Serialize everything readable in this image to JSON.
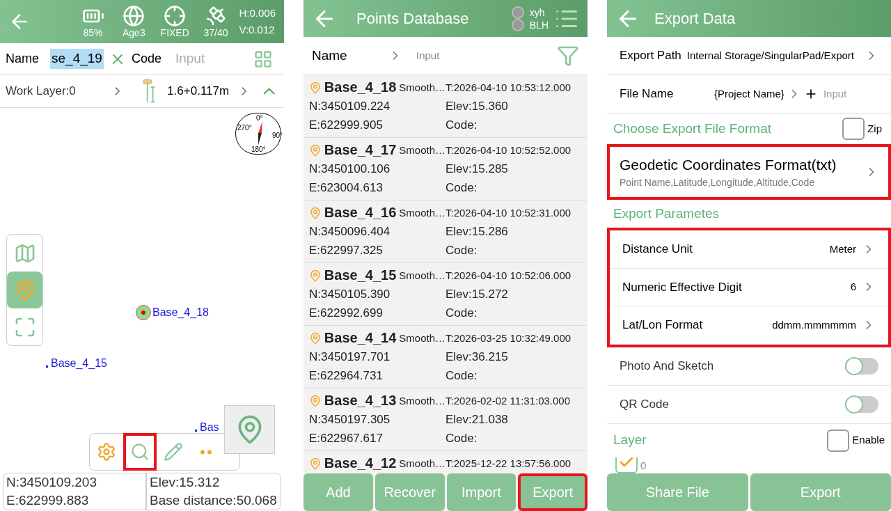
{
  "survey_screen": {
    "status": [
      {
        "kind": "battery",
        "label": "85%"
      },
      {
        "kind": "globe",
        "label": "Age3"
      },
      {
        "kind": "target",
        "label": "FIXED"
      },
      {
        "kind": "satellite",
        "label": "37/40"
      }
    ],
    "precision": [
      "H:0.006",
      "V:0.012"
    ],
    "name_label": "Name",
    "name_value": "se_4_19",
    "code_label": "Code",
    "code_placeholder": "Input",
    "work_layer": "Work Layer:0",
    "antenna_height": "1.6+0.117m",
    "compass": [
      "0°",
      "90°",
      "180°",
      "270°"
    ],
    "map_points": [
      {
        "label": "Base_4_18",
        "kind": "current"
      },
      {
        "label": "Base_4_15",
        "kind": "point"
      },
      {
        "label": "Bas",
        "kind": "point"
      }
    ],
    "side_tools": [
      {
        "kind": "polygon",
        "selected": false
      },
      {
        "kind": "locate",
        "selected": true
      },
      {
        "kind": "fit",
        "selected": false
      }
    ],
    "toolbar": [
      {
        "kind": "settings",
        "highlighted": false
      },
      {
        "kind": "point-search",
        "highlighted": true
      },
      {
        "kind": "sketch",
        "highlighted": false
      },
      {
        "kind": "more",
        "highlighted": false
      }
    ],
    "info": [
      "N:3450109.203",
      "Elev:15.312",
      "E:622999.883",
      "Base distance:50.068"
    ]
  },
  "points_database": {
    "title": "Points Database",
    "modes": [
      {
        "label": "xyh",
        "selected": false
      },
      {
        "label": "BLH",
        "selected": false
      }
    ],
    "filter": {
      "label": "Name",
      "placeholder": "Input"
    },
    "points": [
      {
        "name": "Base_4_18",
        "method": "Smooth…",
        "time": "T:2026-04-10 10:53:12.000",
        "n": "N:3450109.224",
        "elev": "Elev:15.360",
        "e": "E:622999.905",
        "code": "Code:"
      },
      {
        "name": "Base_4_17",
        "method": "Smooth…",
        "time": "T:2026-04-10 10:52:52.000",
        "n": "N:3450100.106",
        "elev": "Elev:15.285",
        "e": "E:623004.613",
        "code": "Code:"
      },
      {
        "name": "Base_4_16",
        "method": "Smooth…",
        "time": "T:2026-04-10 10:52:31.000",
        "n": "N:3450096.404",
        "elev": "Elev:15.286",
        "e": "E:622997.325",
        "code": "Code:"
      },
      {
        "name": "Base_4_15",
        "method": "Smooth…",
        "time": "T:2026-04-10 10:52:06.000",
        "n": "N:3450105.390",
        "elev": "Elev:15.272",
        "e": "E:622992.699",
        "code": "Code:"
      },
      {
        "name": "Base_4_14",
        "method": "Smooth…",
        "time": "T:2026-03-25 10:32:49.000",
        "n": "N:3450197.701",
        "elev": "Elev:36.215",
        "e": "E:622964.731",
        "code": "Code:"
      },
      {
        "name": "Base_4_13",
        "method": "Smooth…",
        "time": "T:2026-02-02 11:31:03.000",
        "n": "N:3450197.305",
        "elev": "Elev:21.038",
        "e": "E:622967.617",
        "code": "Code:"
      },
      {
        "name": "Base_4_12",
        "method": "Smooth…",
        "time": "T:2025-12-22 13:57:56.000"
      }
    ],
    "buttons": [
      {
        "label": "Add",
        "highlighted": false
      },
      {
        "label": "Recover",
        "highlighted": false
      },
      {
        "label": "Import",
        "highlighted": false
      },
      {
        "label": "Export",
        "highlighted": true
      }
    ]
  },
  "export_data": {
    "title": "Export Data",
    "export_path": {
      "label": "Export Path",
      "value": "Internal Storage/SingularPad/Export"
    },
    "file_name": {
      "label": "File Name",
      "value": "{Project Name}",
      "placeholder": "Input"
    },
    "format_section": {
      "title": "Choose Export File Format",
      "zip": {
        "label": "Zip",
        "checked": false
      }
    },
    "format": {
      "name": "Geodetic Coordinates Format(txt)",
      "fields": "Point Name,Latitude,Longitude,Altitude,Code",
      "highlighted": true
    },
    "params_title": "Export Parametes",
    "params_highlighted": true,
    "params": [
      {
        "label": "Distance Unit",
        "value": "Meter"
      },
      {
        "label": "Numeric Effective Digit",
        "value": "6"
      },
      {
        "label": "Lat/Lon Format",
        "value": "ddmm.mmmmmm"
      }
    ],
    "toggles": [
      {
        "label": "Photo And Sketch",
        "on": false
      },
      {
        "label": "QR Code",
        "on": false
      }
    ],
    "layer": {
      "title": "Layer",
      "enable": {
        "label": "Enable",
        "checked": false
      },
      "items": [
        {
          "label": "0",
          "checked": true
        }
      ]
    },
    "buttons": [
      "Share File",
      "Export"
    ]
  }
}
